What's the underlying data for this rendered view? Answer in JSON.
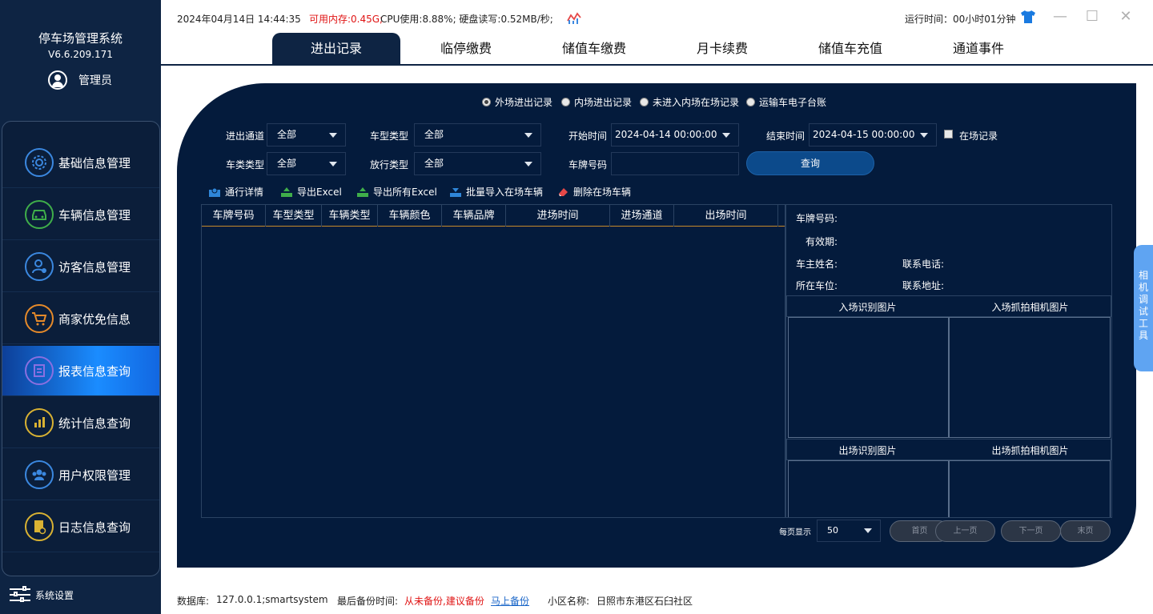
{
  "app": {
    "title": "停车场管理系统",
    "version": "V6.6.209.171",
    "user": "管理员"
  },
  "status": {
    "datetime": "2024年04月14日 14:44:35",
    "memory": "可用内存:0.45G;",
    "cpu_disk": "CPU使用:8.88%; 硬盘读写:0.52MB/秒;",
    "runtime": "运行时间：00小时01分钟"
  },
  "menu": [
    {
      "label": "基础信息管理",
      "icon": "gear-icon",
      "color": "#3b88e0"
    },
    {
      "label": "车辆信息管理",
      "icon": "car-icon",
      "color": "#3fae4a"
    },
    {
      "label": "访客信息管理",
      "icon": "visitor-icon",
      "color": "#3b88e0"
    },
    {
      "label": "商家优免信息",
      "icon": "cart-icon",
      "color": "#e58a2a"
    },
    {
      "label": "报表信息查询",
      "icon": "report-icon",
      "color": "#8a6fe0"
    },
    {
      "label": "统计信息查询",
      "icon": "bar-chart-icon",
      "color": "#d9b233"
    },
    {
      "label": "用户权限管理",
      "icon": "users-icon",
      "color": "#3b88e0"
    },
    {
      "label": "日志信息查询",
      "icon": "log-icon",
      "color": "#d9b233"
    }
  ],
  "settings_label": "系统设置",
  "tabs": [
    "进出记录",
    "临停缴费",
    "储值车缴费",
    "月卡续费",
    "储值车充值",
    "通道事件"
  ],
  "radios": [
    "外场进出记录",
    "内场进出记录",
    "未进入内场在场记录",
    "运输车电子台账"
  ],
  "filters": {
    "channel_label": "进出通道",
    "channel_value": "全部",
    "cartype_label": "车型类型",
    "cartype_value": "全部",
    "start_label": "开始时间",
    "start_value": "2024-04-14 00:00:00",
    "end_label": "结束时间",
    "end_value": "2024-04-15 00:00:00",
    "inpark_label": "在场记录",
    "carclass_label": "车类类型",
    "carclass_value": "全部",
    "release_label": "放行类型",
    "release_value": "全部",
    "plate_label": "车牌号码",
    "query_button": "查询"
  },
  "toolbar": [
    "通行详情",
    "导出Excel",
    "导出所有Excel",
    "批量导入在场车辆",
    "删除在场车辆"
  ],
  "table_headers": [
    "车牌号码",
    "车型类型",
    "车辆类型",
    "车辆颜色",
    "车辆品牌",
    "进场时间",
    "进场通道",
    "出场时间"
  ],
  "detail": {
    "plate": "车牌号码:",
    "valid": "有效期:",
    "owner": "车主姓名:",
    "phone": "联系电话:",
    "slot": "所在车位:",
    "address": "联系地址:",
    "entry_recog": "入场识别图片",
    "entry_capture": "入场抓拍相机图片",
    "exit_recog": "出场识别图片",
    "exit_capture": "出场抓拍相机图片"
  },
  "pagination": {
    "per_page_label": "每页显示",
    "per_page_value": "50",
    "first": "首页",
    "prev": "上一页",
    "next": "下一页",
    "last": "末页"
  },
  "side_tool": "相机调试工具",
  "footer": {
    "db_label": "数据库:",
    "db_value": "127.0.0.1;smartsystem",
    "backup_label": "最后备份时间:",
    "backup_status": "从未备份,建议备份",
    "backup_link": "马上备份",
    "community_label": "小区名称:",
    "community_value": "日照市东港区石臼社区"
  }
}
